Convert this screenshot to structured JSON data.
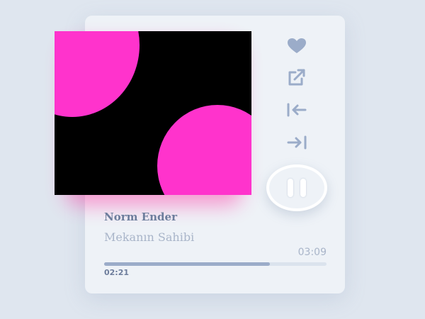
{
  "track": {
    "title": "Norm Ender",
    "artist": "Mekanın Sahibi"
  },
  "playback": {
    "duration": "03:09",
    "elapsed": "02:21",
    "progress_fraction": 0.746,
    "state_icon": "pause-icon"
  },
  "controls": [
    {
      "icon": "heart-icon"
    },
    {
      "icon": "share-external-icon"
    },
    {
      "icon": "skip-back-icon"
    },
    {
      "icon": "skip-forward-icon"
    }
  ],
  "colors": {
    "background": "#dfe6ef",
    "card": "#eef2f7",
    "icon": "#9bacc9",
    "art_background": "#000000",
    "art_shape": "#ff33cc",
    "text_primary": "#6d7d9c",
    "text_secondary": "#a9b5c9"
  }
}
